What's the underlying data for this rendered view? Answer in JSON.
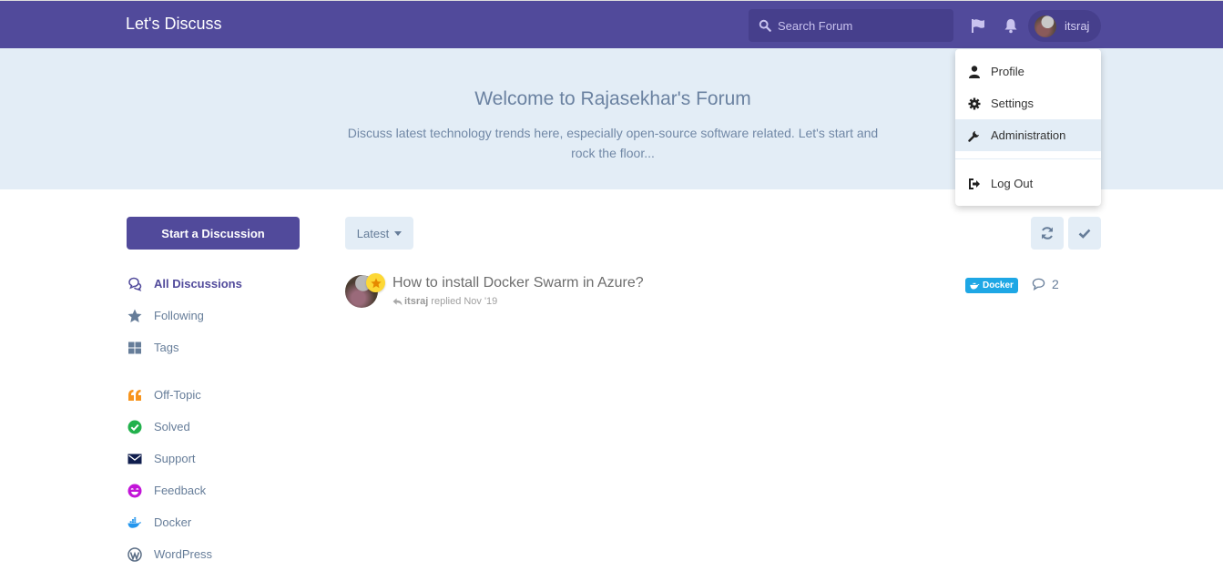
{
  "header": {
    "brand": "Let's Discuss",
    "search_placeholder": "Search Forum",
    "flag_icon": "flag-icon",
    "notifications_icon": "bell-icon",
    "username": "itsraj"
  },
  "user_menu": {
    "items": [
      {
        "label": "Profile",
        "icon": "user-icon"
      },
      {
        "label": "Settings",
        "icon": "gear-icon"
      },
      {
        "label": "Administration",
        "icon": "wrench-icon",
        "active": true
      },
      {
        "label": "Log Out",
        "icon": "sign-out-icon"
      }
    ]
  },
  "hero": {
    "title": "Welcome to Rajasekhar's Forum",
    "description": "Discuss latest technology trends here, especially open-source software related. Let's start and rock the floor..."
  },
  "sidebar": {
    "start_button": "Start a Discussion",
    "nav": [
      {
        "label": "All Discussions",
        "icon": "comments-icon",
        "active": true
      },
      {
        "label": "Following",
        "icon": "star-icon"
      },
      {
        "label": "Tags",
        "icon": "grid-icon"
      }
    ],
    "tags": [
      {
        "label": "Off-Topic",
        "icon": "quote-icon",
        "color": "#f7941d"
      },
      {
        "label": "Solved",
        "icon": "check-circle-icon",
        "color": "#22b14c"
      },
      {
        "label": "Support",
        "icon": "envelope-icon",
        "color": "#0f1d4d"
      },
      {
        "label": "Feedback",
        "icon": "smile-icon",
        "color": "#c215d8"
      },
      {
        "label": "Docker",
        "icon": "docker-icon",
        "color": "#2496ed"
      },
      {
        "label": "WordPress",
        "icon": "wordpress-icon",
        "color": "#5a6d85"
      }
    ]
  },
  "toolbar": {
    "sort_label": "Latest",
    "refresh_icon": "refresh-icon",
    "mark_read_icon": "check-icon"
  },
  "discussions": [
    {
      "title": "How to install Docker Swarm in Azure?",
      "author": "itsraj",
      "action": "replied",
      "date": "Nov '19",
      "tag": "Docker",
      "tag_color": "#1ea7e5",
      "replies": "2",
      "badge": "star"
    }
  ],
  "colors": {
    "primary": "#514a9b",
    "hero_bg": "#e3edf6",
    "text_muted": "#667d99"
  }
}
